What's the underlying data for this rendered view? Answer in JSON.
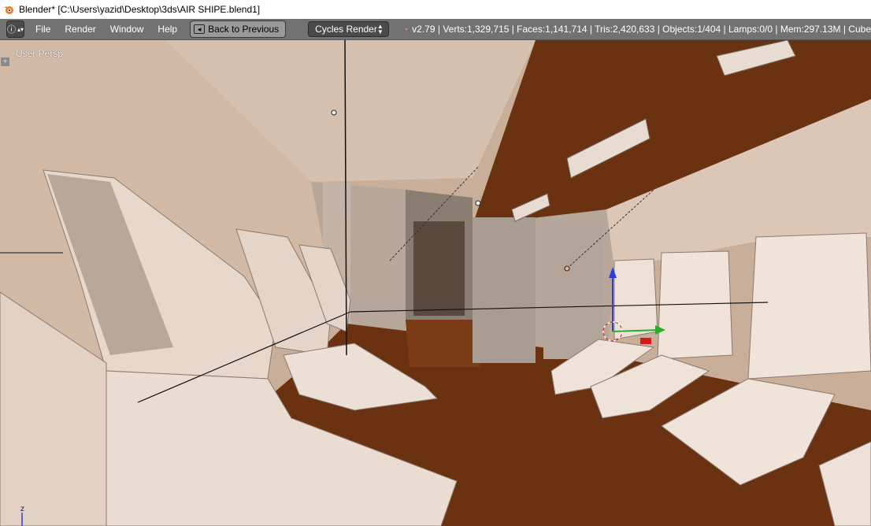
{
  "window": {
    "title": "Blender* [C:\\Users\\yazid\\Desktop\\3ds\\AIR SHIPE.blend1]"
  },
  "header": {
    "editor_type_icon": "info-icon",
    "menus": [
      "File",
      "Render",
      "Window",
      "Help"
    ],
    "back_button": "Back to Previous",
    "render_engine": "Cycles Render",
    "stats": "v2.79 | Verts:1,329,715 | Faces:1,141,714 | Tris:2,420,633 | Objects:1/404 | Lamps:0/0 | Mem:297.13M | Cube"
  },
  "viewport": {
    "view_label": "User Persp",
    "axis_label": "z"
  },
  "colors": {
    "header_bg": "#727272",
    "floor": "#6a3210",
    "wall": "#d9c3b3",
    "seat": "#e8d8cc"
  }
}
